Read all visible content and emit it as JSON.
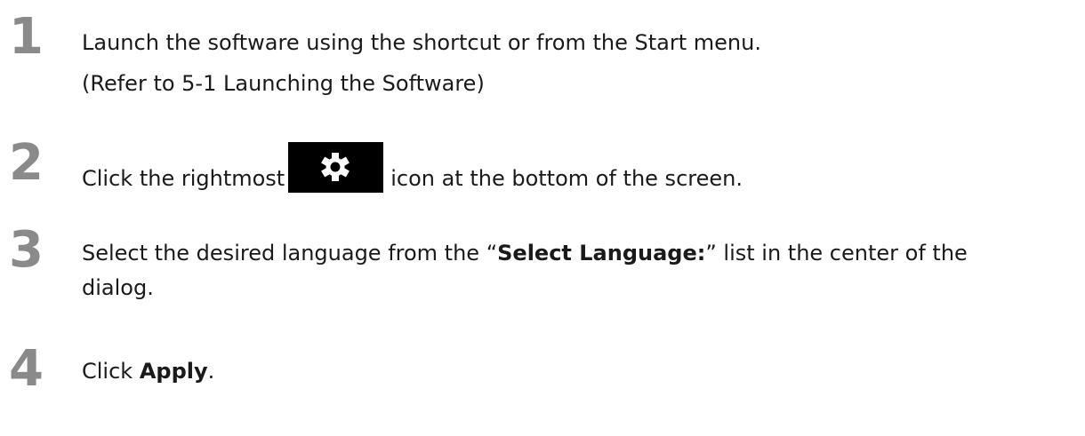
{
  "steps": [
    {
      "number": "1",
      "lines": [
        "Launch the software using the shortcut or from the Start menu.",
        "(Refer to 5-1   Launching the Software)"
      ]
    },
    {
      "number": "2",
      "before_icon": "Click the rightmost",
      "icon": "gear-icon",
      "after_icon": "icon at the bottom of the screen."
    },
    {
      "number": "3",
      "line1_before": "Select the desired language from the “",
      "line1_bold": "Select Language:",
      "line1_after": "” list in the center of the",
      "line2": "dialog."
    },
    {
      "number": "4",
      "before_bold": "Click ",
      "bold": "Apply",
      "after_bold": "."
    }
  ],
  "colors": {
    "step_number": "#8a8a8a",
    "text": "#1a1a1a",
    "icon_background": "#000000",
    "icon_glyph": "#ffffff"
  }
}
